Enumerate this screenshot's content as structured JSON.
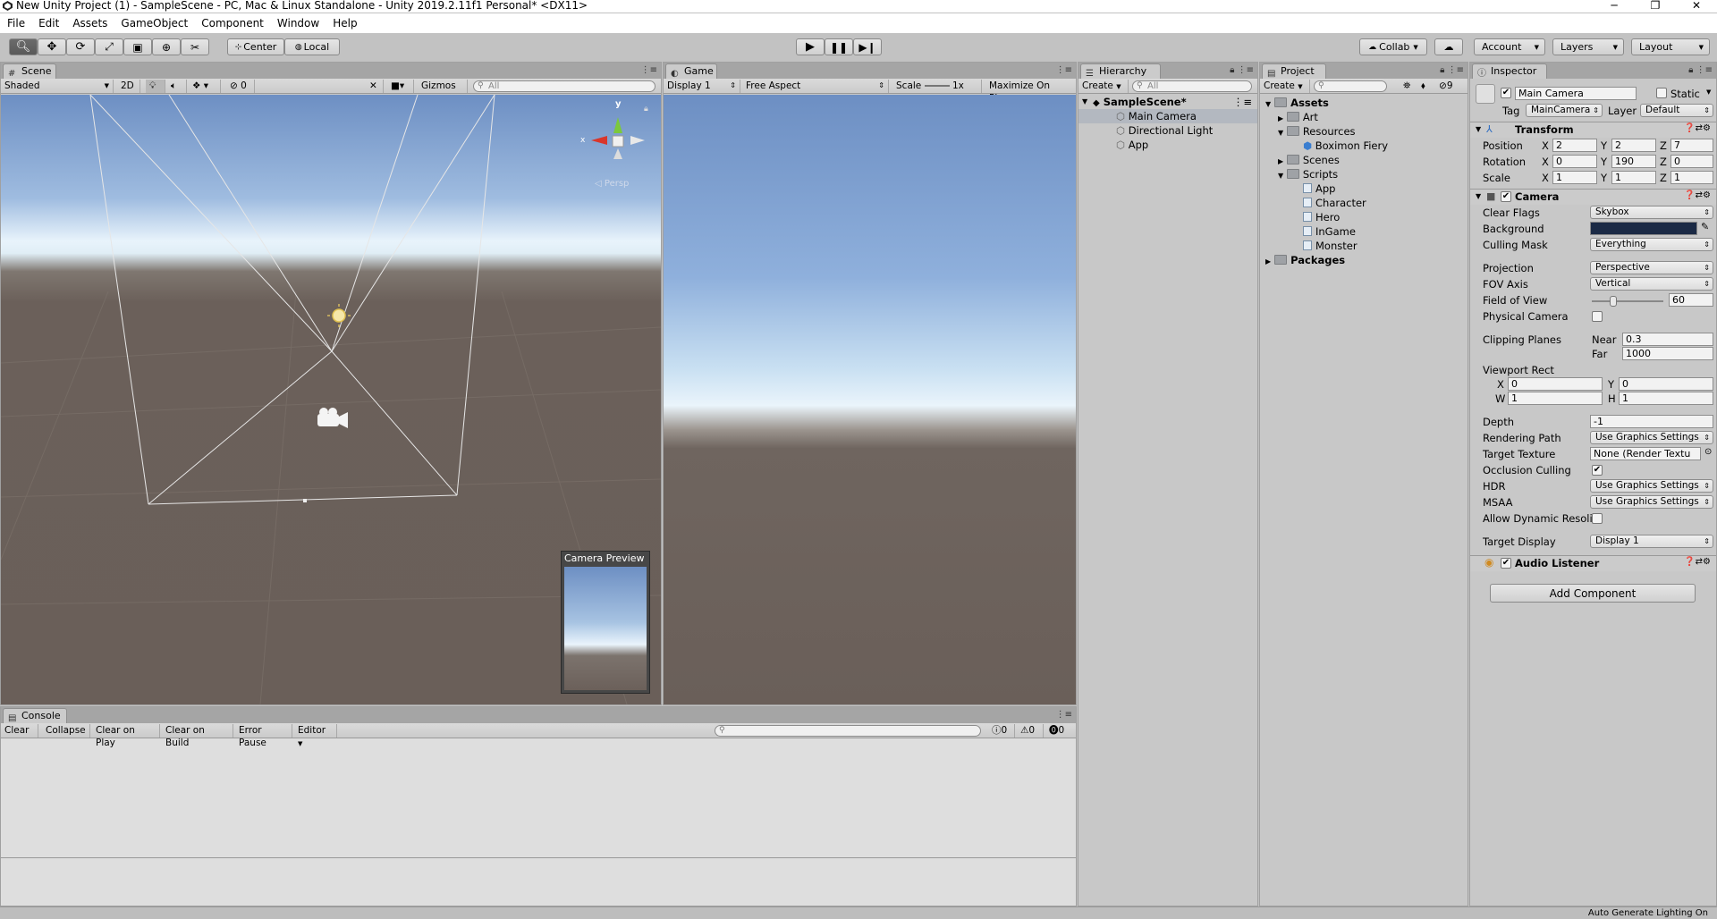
{
  "window": {
    "title": "New Unity Project (1) - SampleScene - PC, Mac & Linux Standalone - Unity 2019.2.11f1 Personal* <DX11>",
    "minimize": "─",
    "maximize": "❐",
    "close": "✕"
  },
  "menu": [
    "File",
    "Edit",
    "Assets",
    "GameObject",
    "Component",
    "Window",
    "Help"
  ],
  "toolbar": {
    "pivot_center": "Center",
    "pivot_local": "Local",
    "collab": "Collab",
    "account": "Account",
    "layers": "Layers",
    "layout": "Layout"
  },
  "scene": {
    "tab": "Scene",
    "shading": "Shaded",
    "mode2d": "2D",
    "fx_count": "0",
    "gizmos": "Gizmos",
    "search_placeholder": "All",
    "persp": "Persp",
    "gizmo_x": "x",
    "gizmo_y": "y",
    "camera_preview": "Camera Preview"
  },
  "game": {
    "tab": "Game",
    "display": "Display 1",
    "aspect": "Free Aspect",
    "scale_label": "Scale",
    "scale_value": "1x",
    "maximize": "Maximize On Play"
  },
  "hierarchy": {
    "tab": "Hierarchy",
    "create": "Create",
    "search_placeholder": "All",
    "scene": "SampleScene*",
    "items": [
      "Main Camera",
      "Directional Light",
      "App"
    ]
  },
  "project": {
    "tab": "Project",
    "create": "Create",
    "count": "9",
    "assets": "Assets",
    "art": "Art",
    "resources": "Resources",
    "boximon": "Boximon Fiery",
    "scenes": "Scenes",
    "scripts_folder": "Scripts",
    "scripts": [
      "App",
      "Character",
      "Hero",
      "InGame",
      "Monster"
    ],
    "packages": "Packages"
  },
  "inspector": {
    "tab": "Inspector",
    "object_name": "Main Camera",
    "static": "Static",
    "tag_label": "Tag",
    "tag": "MainCamera",
    "layer_label": "Layer",
    "layer": "Default",
    "transform": {
      "title": "Transform",
      "position": "Position",
      "rotation": "Rotation",
      "scale": "Scale",
      "pos": [
        "2",
        "2",
        "7"
      ],
      "rot": [
        "0",
        "190",
        "0"
      ],
      "scl": [
        "1",
        "1",
        "1"
      ],
      "x": "X",
      "y": "Y",
      "z": "Z"
    },
    "camera": {
      "title": "Camera",
      "clear_flags": "Clear Flags",
      "clear_flags_val": "Skybox",
      "background": "Background",
      "culling_mask": "Culling Mask",
      "culling_mask_val": "Everything",
      "projection": "Projection",
      "projection_val": "Perspective",
      "fov_axis": "FOV Axis",
      "fov_axis_val": "Vertical",
      "fov": "Field of View",
      "fov_val": "60",
      "fov_fraction": 0.3,
      "physical": "Physical Camera",
      "clipping": "Clipping Planes",
      "near": "Near",
      "near_val": "0.3",
      "far": "Far",
      "far_val": "1000",
      "viewport": "Viewport Rect",
      "vx": "X",
      "vx_val": "0",
      "vy": "Y",
      "vy_val": "0",
      "vw": "W",
      "vw_val": "1",
      "vh": "H",
      "vh_val": "1",
      "depth": "Depth",
      "depth_val": "-1",
      "rendering_path": "Rendering Path",
      "rendering_path_val": "Use Graphics Settings",
      "target_texture": "Target Texture",
      "target_texture_val": "None (Render Textu",
      "occlusion": "Occlusion Culling",
      "hdr": "HDR",
      "hdr_val": "Use Graphics Settings",
      "msaa": "MSAA",
      "msaa_val": "Use Graphics Settings",
      "dynres": "Allow Dynamic Resoli",
      "target_display": "Target Display",
      "target_display_val": "Display 1"
    },
    "audio": {
      "title": "Audio Listener"
    },
    "add_component": "Add Component"
  },
  "console": {
    "tab": "Console",
    "clear": "Clear",
    "collapse": "Collapse",
    "clear_on_play": "Clear on Play",
    "clear_on_build": "Clear on Build",
    "error_pause": "Error Pause",
    "editor": "Editor",
    "info_count": "0",
    "warn_count": "0",
    "error_count": "0"
  },
  "status": {
    "text": "Auto Generate Lighting On"
  },
  "colors": {
    "sky_top": "#6d8fc3",
    "horizon": "#eaf4fb",
    "ground": "#6b605a",
    "camera_bg": "#1b2a45"
  }
}
